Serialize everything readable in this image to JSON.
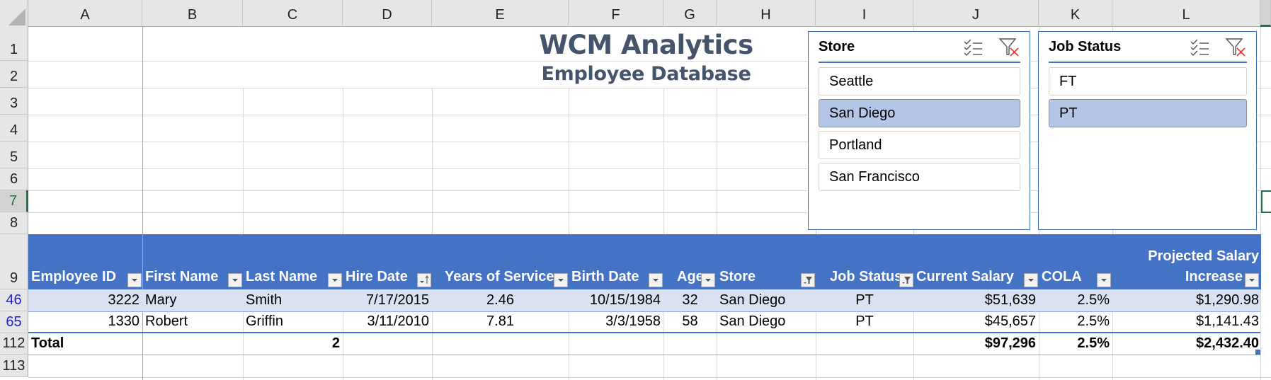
{
  "sheet": {
    "columns": [
      "A",
      "B",
      "C",
      "D",
      "E",
      "F",
      "G",
      "H",
      "I",
      "J",
      "K",
      "L"
    ],
    "active_column": "M",
    "rows_top": [
      "1",
      "2",
      "3",
      "4",
      "5",
      "6",
      "7",
      "8"
    ],
    "active_row": "7",
    "header_row": "9",
    "data_row_numbers": [
      "46",
      "65"
    ],
    "total_row_number": "112",
    "blank_row_number": "113"
  },
  "title": {
    "main": "WCM Analytics",
    "sub": "Employee Database"
  },
  "slicers": [
    {
      "title": "Store",
      "items": [
        {
          "label": "Seattle",
          "selected": false
        },
        {
          "label": "San Diego",
          "selected": true
        },
        {
          "label": "Portland",
          "selected": false
        },
        {
          "label": "San Francisco",
          "selected": false
        }
      ]
    },
    {
      "title": "Job Status",
      "items": [
        {
          "label": "FT",
          "selected": false
        },
        {
          "label": "PT",
          "selected": true
        }
      ]
    }
  ],
  "table": {
    "headers": [
      {
        "label": "Employee ID",
        "button": "dropdown"
      },
      {
        "label": "First Name",
        "button": "dropdown"
      },
      {
        "label": "Last Name",
        "button": "dropdown"
      },
      {
        "label": "Hire Date",
        "button": "sort-ascending"
      },
      {
        "label": "Years of Service",
        "button": "dropdown"
      },
      {
        "label": "Birth Date",
        "button": "dropdown"
      },
      {
        "label": "Age",
        "button": "dropdown"
      },
      {
        "label": "Store",
        "button": "filtered"
      },
      {
        "label": "Job Status",
        "button": "filtered"
      },
      {
        "label": "Current Salary",
        "button": "dropdown"
      },
      {
        "label": "COLA",
        "button": "dropdown"
      },
      {
        "label": "Projected Salary Increase",
        "label_line1": "Projected Salary",
        "label_line2": "Increase",
        "button": "dropdown"
      }
    ],
    "rows": [
      [
        "3222",
        "Mary",
        "Smith",
        "7/17/2015",
        "2.46",
        "10/15/1984",
        "32",
        "San Diego",
        "PT",
        "$51,639",
        "2.5%",
        "$1,290.98"
      ],
      [
        "1330",
        "Robert",
        "Griffin",
        "3/11/2010",
        "7.81",
        "3/3/1958",
        "58",
        "San Diego",
        "PT",
        "$45,657",
        "2.5%",
        "$1,141.43"
      ]
    ],
    "total": {
      "label": "Total",
      "count": "2",
      "current_salary": "$97,296",
      "cola": "2.5%",
      "projected_increase": "$2,432.40"
    }
  },
  "colors": {
    "header_blue": "#4472c4",
    "band_blue": "#d9e1f2",
    "slicer_selected": "#b4c6e7",
    "title_slate": "#44546a",
    "excel_green": "#217346"
  }
}
